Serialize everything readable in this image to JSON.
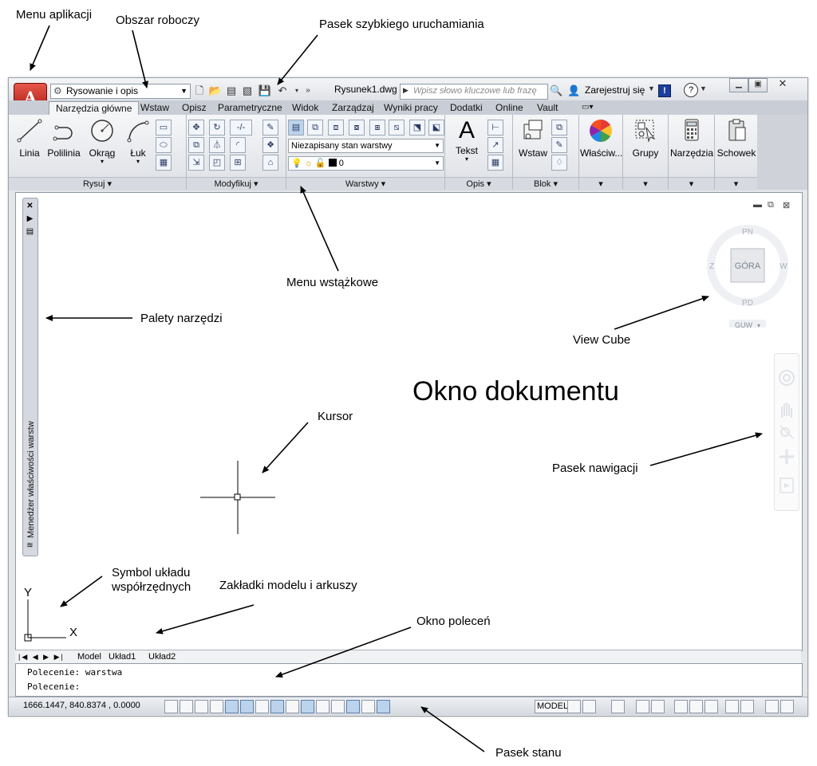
{
  "callouts": {
    "app_menu": "Menu aplikacji",
    "workspace": "Obszar roboczy",
    "quick_access": "Pasek szybkiego uruchamiania",
    "ribbon": "Menu wstążkowe",
    "tool_palettes": "Palety narzędzi",
    "view_cube": "View Cube",
    "cursor": "Kursor",
    "nav_bar": "Pasek nawigacji",
    "ucs_symbol": "Symbol układu współrzędnych",
    "layout_tabs": "Zakładki modelu i arkuszy",
    "command_window": "Okno poleceń",
    "status_bar": "Pasek stanu",
    "document_window": "Okno dokumentu"
  },
  "titlebar": {
    "workspace_selector": "Rysowanie i opis",
    "document_title": "Rysunek1.dwg",
    "search_placeholder": "Wpisz słowo kluczowe lub frazę",
    "register": "Zarejestruj się",
    "app_icon_letter": "A"
  },
  "ribbon": {
    "tabs": [
      "Narzędzia główne",
      "Wstaw",
      "Opisz",
      "Parametryczne",
      "Widok",
      "Zarządzaj",
      "Wyniki pracy",
      "Dodatki",
      "Online",
      "Vault"
    ],
    "active_tab": "Narzędzia główne",
    "draw_buttons": [
      "Linia",
      "Polilinia",
      "Okrąg",
      "Łuk"
    ],
    "panels": [
      "Rysuj ▾",
      "Modyfikuj ▾",
      "Warstwy ▾",
      "Opis ▾",
      "Blok ▾"
    ],
    "layer_state": "Niezapisany stan warstwy",
    "layer_current": "0",
    "annotation_button": "Tekst",
    "block_button": "Wstaw",
    "big_buttons": [
      "Właściw...",
      "Grupy",
      "Narzędzia",
      "Schowek"
    ],
    "text_icon": "A"
  },
  "palette": {
    "label": "Menedżer właściwości warstw"
  },
  "viewcube": {
    "top": "GÓRA",
    "north": "PN",
    "south": "PD",
    "west": "Z",
    "east": "W",
    "ucs": "GUW"
  },
  "layout_tabs": [
    "Model",
    "Układ1",
    "Układ2"
  ],
  "command_window": {
    "line1": "Polecenie: warstwa",
    "line2": "Polecenie:"
  },
  "status": {
    "coordinates": "1666.1447, 840.8374 , 0.0000",
    "model": "MODEL"
  },
  "ucs_labels": {
    "x": "X",
    "y": "Y"
  }
}
